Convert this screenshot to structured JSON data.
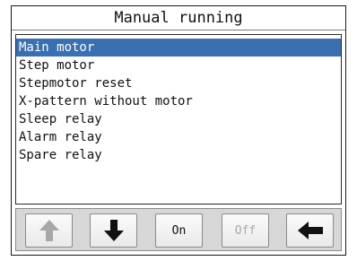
{
  "window": {
    "title": "Manual running"
  },
  "list": {
    "items": [
      {
        "label": "Main motor",
        "selected": true
      },
      {
        "label": "Step motor",
        "selected": false
      },
      {
        "label": "Stepmotor reset",
        "selected": false
      },
      {
        "label": "X-pattern without motor",
        "selected": false
      },
      {
        "label": "Sleep relay",
        "selected": false
      },
      {
        "label": "Alarm relay",
        "selected": false
      },
      {
        "label": "Spare relay",
        "selected": false
      }
    ]
  },
  "toolbar": {
    "up": {
      "icon": "arrow-up-icon",
      "enabled": false
    },
    "down": {
      "icon": "arrow-down-icon",
      "enabled": true
    },
    "on_label": "On",
    "off_label": "Off",
    "off_enabled": false,
    "back": {
      "icon": "arrow-left-icon",
      "enabled": true
    }
  },
  "colors": {
    "selection": "#3a6fb0",
    "toolbar_bg": "#d7d7d7",
    "disabled": "#a8a8a8"
  }
}
